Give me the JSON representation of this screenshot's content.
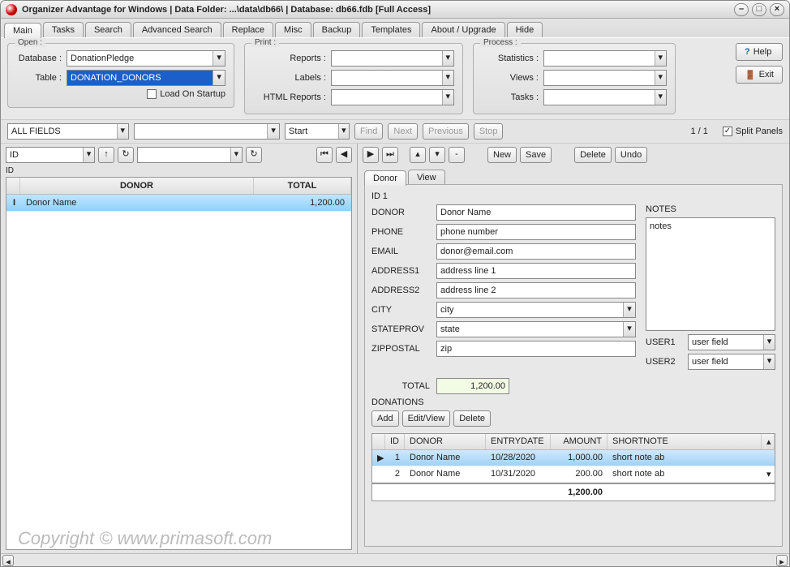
{
  "title": "Organizer Advantage for Windows | Data Folder: ...\\data\\db66\\ | Database: db66.fdb [Full Access]",
  "tabs": [
    "Main",
    "Tasks",
    "Search",
    "Advanced Search",
    "Replace",
    "Misc",
    "Backup",
    "Templates",
    "About / Upgrade",
    "Hide"
  ],
  "open": {
    "legend": "Open :",
    "database_label": "Database :",
    "database_value": "DonationPledge",
    "table_label": "Table :",
    "table_value": "DONATION_DONORS",
    "load_on_startup": "Load On Startup"
  },
  "print": {
    "legend": "Print :",
    "reports": "Reports :",
    "labels": "Labels :",
    "html": "HTML Reports :"
  },
  "process": {
    "legend": "Process :",
    "statistics": "Statistics :",
    "views": "Views :",
    "tasks": "Tasks :"
  },
  "help": "Help",
  "exit": "Exit",
  "search": {
    "allfields": "ALL FIELDS",
    "start": "Start",
    "find": "Find",
    "next": "Next",
    "previous": "Previous",
    "stop": "Stop",
    "pager": "1 / 1",
    "split": "Split Panels"
  },
  "leftgrid": {
    "sortfield": "ID",
    "sortfield_small": "ID",
    "col_donor": "DONOR",
    "col_total": "TOTAL",
    "row_marker": "I",
    "row_donor": "Donor Name",
    "row_total": "1,200.00"
  },
  "detail": {
    "new": "New",
    "save": "Save",
    "delete": "Delete",
    "undo": "Undo",
    "tab_donor": "Donor",
    "tab_view": "View",
    "id_label": "ID",
    "id_value": "1",
    "donor_label": "DONOR",
    "donor_value": "Donor Name",
    "phone_label": "PHONE",
    "phone_value": "phone number",
    "email_label": "EMAIL",
    "email_value": "donor@email.com",
    "addr1_label": "ADDRESS1",
    "addr1_value": "address line 1",
    "addr2_label": "ADDRESS2",
    "addr2_value": "address line 2",
    "city_label": "CITY",
    "city_value": "city",
    "state_label": "STATEPROV",
    "state_value": "state",
    "zip_label": "ZIPPOSTAL",
    "zip_value": "zip",
    "notes_label": "NOTES",
    "notes_value": "notes",
    "user1_label": "USER1",
    "user1_value": "user field",
    "user2_label": "USER2",
    "user2_value": "user field",
    "total_label": "TOTAL",
    "total_value": "1,200.00",
    "donations_label": "DONATIONS",
    "add": "Add",
    "editview": "Edit/View",
    "del": "Delete",
    "sub_cols": {
      "id": "ID",
      "donor": "DONOR",
      "date": "ENTRYDATE",
      "amount": "AMOUNT",
      "note": "SHORTNOTE"
    },
    "sub_rows": [
      {
        "id": "1",
        "donor": "Donor Name",
        "date": "10/28/2020",
        "amount": "1,000.00",
        "note": "short note ab"
      },
      {
        "id": "2",
        "donor": "Donor Name",
        "date": "10/31/2020",
        "amount": "200.00",
        "note": "short note ab"
      }
    ],
    "sub_total": "1,200.00"
  },
  "watermark": "Copyright ©   www.primasoft.com"
}
